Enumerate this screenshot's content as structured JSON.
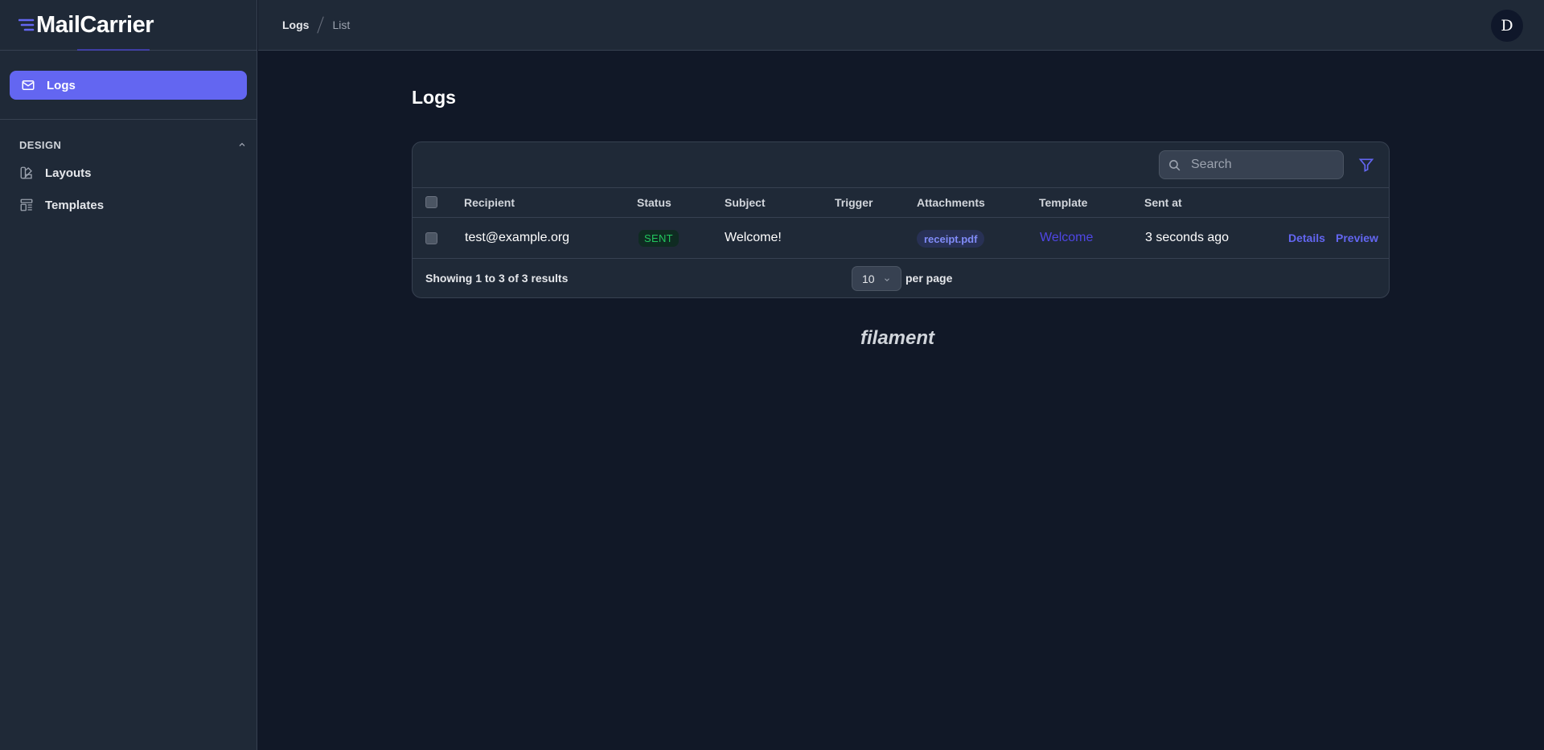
{
  "brand": {
    "name": "MailCarrier",
    "accent": "#6366f1"
  },
  "sidebar": {
    "active_item": {
      "label": "Logs",
      "icon": "envelope-icon"
    },
    "group": {
      "label": "DESIGN",
      "items": [
        {
          "label": "Layouts",
          "icon": "swatch-icon"
        },
        {
          "label": "Templates",
          "icon": "template-icon"
        }
      ]
    }
  },
  "topbar": {
    "breadcrumbs": [
      "Logs",
      "List"
    ],
    "avatar_initial": "D"
  },
  "page": {
    "title": "Logs"
  },
  "table": {
    "search_placeholder": "Search",
    "columns": [
      "Recipient",
      "Status",
      "Subject",
      "Trigger",
      "Attachments",
      "Template",
      "Sent at"
    ],
    "rows": [
      {
        "recipient": "test@example.org",
        "status": "SENT",
        "subject": "Welcome!",
        "trigger": "",
        "attachment": "receipt.pdf",
        "template": "Welcome",
        "sent_at": "3 seconds ago",
        "actions": [
          "Details",
          "Preview"
        ]
      }
    ],
    "footer": {
      "showing": "Showing 1 to 3 of 3 results",
      "per_page_value": "10",
      "per_page_label": "per page"
    }
  },
  "footer_logo": "filament",
  "colors": {
    "background": "#111827",
    "surface": "#1f2937",
    "success": "#22c55e",
    "link": "#6366f1"
  }
}
